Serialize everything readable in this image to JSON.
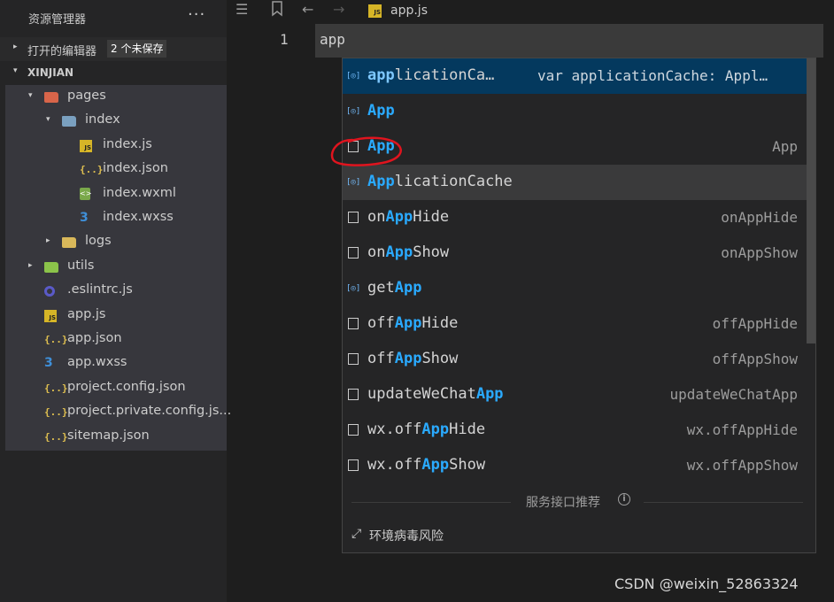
{
  "explorer": {
    "title": "资源管理器",
    "more": "···",
    "open_editors": {
      "label": "打开的编辑器",
      "badge": "2 个未保存"
    },
    "project": "XINJIAN",
    "items": [
      {
        "name": "pages",
        "icon": "folder-red-open-icon",
        "depth": 0,
        "caret": "▾"
      },
      {
        "name": "index",
        "icon": "folder-open-icon",
        "depth": 1,
        "caret": "▾"
      },
      {
        "name": "index.js",
        "icon": "js-file-icon",
        "depth": 2,
        "caret": ""
      },
      {
        "name": "index.json",
        "icon": "json-file-icon",
        "depth": 2,
        "caret": ""
      },
      {
        "name": "index.wxml",
        "icon": "wxml-file-icon",
        "depth": 2,
        "caret": ""
      },
      {
        "name": "index.wxss",
        "icon": "css-file-icon",
        "depth": 2,
        "caret": ""
      },
      {
        "name": "logs",
        "icon": "folder-icon",
        "depth": 1,
        "caret": "▸"
      },
      {
        "name": "utils",
        "icon": "folder-green-icon",
        "depth": 0,
        "caret": "▸"
      },
      {
        "name": ".eslintrc.js",
        "icon": "eslint-file-icon",
        "depth": 0,
        "caret": ""
      },
      {
        "name": "app.js",
        "icon": "js-file-icon",
        "depth": 0,
        "caret": ""
      },
      {
        "name": "app.json",
        "icon": "json-file-icon",
        "depth": 0,
        "caret": ""
      },
      {
        "name": "app.wxss",
        "icon": "css-file-icon",
        "depth": 0,
        "caret": ""
      },
      {
        "name": "project.config.json",
        "icon": "json-file-icon",
        "depth": 0,
        "caret": ""
      },
      {
        "name": "project.private.config.js...",
        "icon": "json-file-icon",
        "depth": 0,
        "caret": ""
      },
      {
        "name": "sitemap.json",
        "icon": "json-file-icon",
        "depth": 0,
        "caret": ""
      }
    ]
  },
  "editor": {
    "toolbar_icons": [
      "list-icon",
      "bookmark-icon",
      "back-arrow-icon",
      "forward-arrow-icon"
    ],
    "tab": {
      "icon": "js-file-icon",
      "name": "app.js"
    },
    "line_number": "1",
    "code": "app"
  },
  "suggest": {
    "items": [
      {
        "kind": "variable",
        "match": "app",
        "rest": "licationCa…",
        "detail": "var applicationCache: Appl…",
        "state": "selected"
      },
      {
        "kind": "variable",
        "match": "App",
        "rest": "",
        "detail": "",
        "state": ""
      },
      {
        "kind": "module",
        "match": "App",
        "rest": "",
        "detail": "App",
        "state": ""
      },
      {
        "kind": "variable",
        "match": "App",
        "rest": "licationCache",
        "detail": "",
        "state": "hover"
      },
      {
        "kind": "module",
        "pre": "on",
        "match": "App",
        "rest": "Hide",
        "detail": "onAppHide",
        "state": ""
      },
      {
        "kind": "module",
        "pre": "on",
        "match": "App",
        "rest": "Show",
        "detail": "onAppShow",
        "state": ""
      },
      {
        "kind": "variable",
        "pre": "get",
        "match": "App",
        "rest": "",
        "detail": "",
        "state": ""
      },
      {
        "kind": "module",
        "pre": "off",
        "match": "App",
        "rest": "Hide",
        "detail": "offAppHide",
        "state": ""
      },
      {
        "kind": "module",
        "pre": "off",
        "match": "App",
        "rest": "Show",
        "detail": "offAppShow",
        "state": ""
      },
      {
        "kind": "module",
        "pre": "updateWeChat",
        "match": "App",
        "rest": "",
        "detail": "updateWeChatApp",
        "state": ""
      },
      {
        "kind": "module",
        "pre": "wx.off",
        "match": "App",
        "rest": "Hide",
        "detail": "wx.offAppHide",
        "state": ""
      },
      {
        "kind": "module",
        "pre": "wx.off",
        "match": "App",
        "rest": "Show",
        "detail": "wx.offAppShow",
        "state": ""
      }
    ],
    "footer_title": "服务接口推荐",
    "footer_link": "环境病毒风险"
  },
  "watermark": "CSDN @weixin_52863324",
  "colors": {
    "selected": "#04395e",
    "highlight": "#2aaaff",
    "annotation": "#e0141e"
  }
}
